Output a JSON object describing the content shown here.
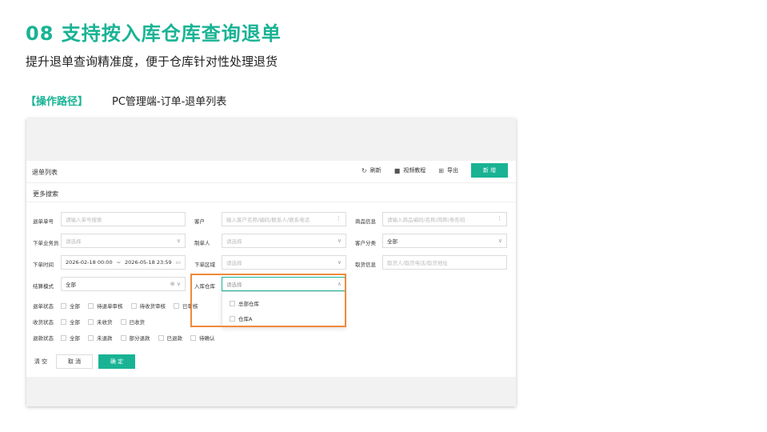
{
  "slide": {
    "title": "08  支持按入库仓库查询退单",
    "subtitle": "提升退单查询精准度，便于仓库针对性处理退货",
    "path_label": "【操作路径】",
    "path_value": "PC管理端-订单-退单列表"
  },
  "app": {
    "page_title": "退单列表",
    "toolbar": {
      "refresh": "刷新",
      "video": "视频教程",
      "export": "导出",
      "new": "新 增"
    },
    "more_search": "更多搜索",
    "form": {
      "return_no": {
        "label": "退单单号",
        "placeholder": "请输入单号搜索"
      },
      "customer": {
        "label": "客户",
        "placeholder": "输入客户名称/编码/联系人/联系电话"
      },
      "product": {
        "label": "商品信息",
        "placeholder": "请输入商品编码/名称/简称/条形码"
      },
      "salesman": {
        "label": "下单业务员",
        "placeholder": "请选择"
      },
      "creator": {
        "label": "制单人",
        "placeholder": "请选择"
      },
      "customer_class": {
        "label": "客户分类",
        "value": "全部"
      },
      "order_time": {
        "label": "下单时间",
        "start": "2026-02-18 00:00",
        "sep": "~",
        "end": "2026-05-18 23:59"
      },
      "region": {
        "label": "下单区域",
        "placeholder": "请选择"
      },
      "pickup": {
        "label": "取货信息",
        "placeholder": "取货人/取货电话/取货地址"
      },
      "settle": {
        "label": "结算模式",
        "value": "全部"
      },
      "warehouse": {
        "label": "入库仓库",
        "placeholder": "请选择",
        "options": [
          "总部仓库",
          "仓库A"
        ]
      },
      "return_status": {
        "label": "退单状态",
        "options": [
          "全部",
          "待退单审核",
          "待收货审核",
          "已审核"
        ]
      },
      "receive_status": {
        "label": "收货状态",
        "options": [
          "全部",
          "未收货",
          "已收货"
        ]
      },
      "refund_status": {
        "label": "退款状态",
        "options": [
          "全部",
          "未退款",
          "部分退款",
          "已退款",
          "待确认"
        ]
      }
    },
    "buttons": {
      "clear": "清 空",
      "cancel": "取 消",
      "ok": "确 定"
    }
  },
  "colors": {
    "accent": "#19b394",
    "highlight": "#f08a3a"
  }
}
